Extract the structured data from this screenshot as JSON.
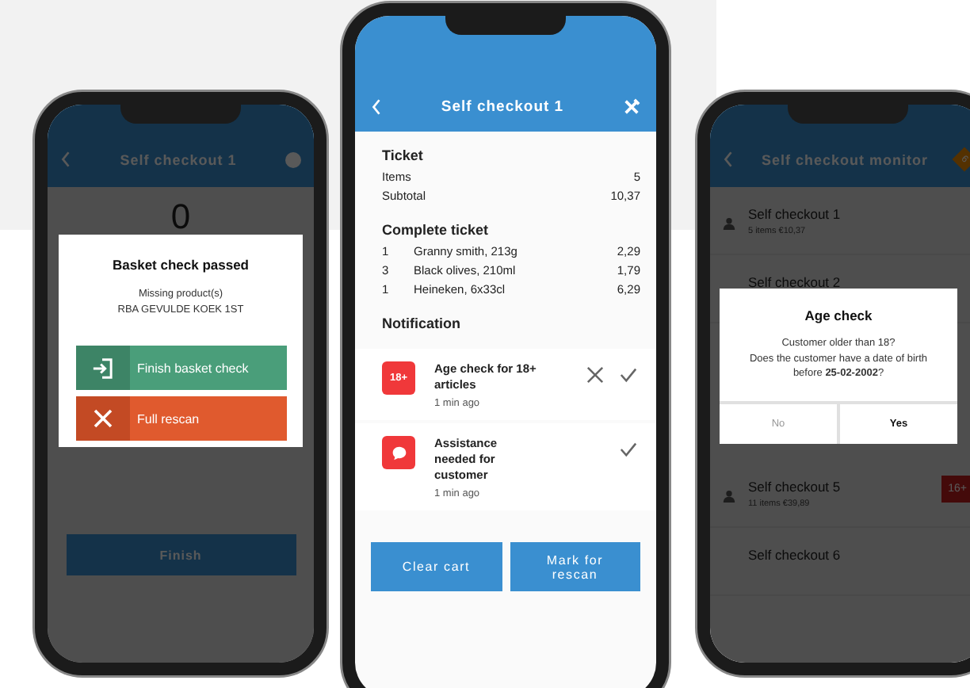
{
  "left_phone": {
    "title": "Self checkout 1",
    "count": "0",
    "finish_button": "Finish",
    "dialog": {
      "title": "Basket check passed",
      "lines": [
        "Missing product(s)",
        "RBA GEVULDE KOEK 1ST"
      ],
      "actions": [
        {
          "kind": "finish",
          "label": "Finish basket check"
        },
        {
          "kind": "rescan",
          "label": "Full rescan"
        }
      ]
    }
  },
  "center_phone": {
    "title": "Self checkout 1",
    "ticket": {
      "heading": "Ticket",
      "rows": [
        {
          "label": "Items",
          "value": "5"
        },
        {
          "label": "Subtotal",
          "value": "10,37"
        }
      ]
    },
    "complete_ticket": {
      "heading": "Complete ticket",
      "rows": [
        {
          "qty": "1",
          "name": "Granny smith, 213g",
          "price": "2,29"
        },
        {
          "qty": "3",
          "name": "Black olives, 210ml",
          "price": "1,79"
        },
        {
          "qty": "1",
          "name": "Heineken, 6x33cl",
          "price": "6,29"
        }
      ]
    },
    "notifications": {
      "heading": "Notification",
      "items": [
        {
          "kind": "age",
          "badge": "18+",
          "title": "Age check for 18+ articles",
          "time": "1 min ago",
          "dismissible": true
        },
        {
          "kind": "assistance",
          "title": "Assistance needed for customer",
          "time": "1 min ago",
          "dismissible": false
        }
      ]
    },
    "buttons": [
      "Clear cart",
      "Mark for rescan"
    ]
  },
  "right_phone": {
    "title": "Self checkout monitor",
    "alert_count": "6",
    "items": [
      {
        "name": "Self checkout 1",
        "detail": "5 items  €10,37",
        "occupied": true
      },
      {
        "name": "Self checkout 2",
        "occupied": false
      },
      {
        "name": "Self checkout 5",
        "detail": "11 items  €39,89",
        "occupied": true,
        "badge": "16+"
      },
      {
        "name": "Self checkout 6",
        "occupied": false
      }
    ],
    "dialog": {
      "title": "Age check",
      "lines": [
        "Customer older than 18?",
        "Does the customer have a date of birth before **25-02-2002**?"
      ],
      "buttons": [
        {
          "label": "No",
          "primary": false
        },
        {
          "label": "Yes",
          "primary": true
        }
      ]
    }
  }
}
